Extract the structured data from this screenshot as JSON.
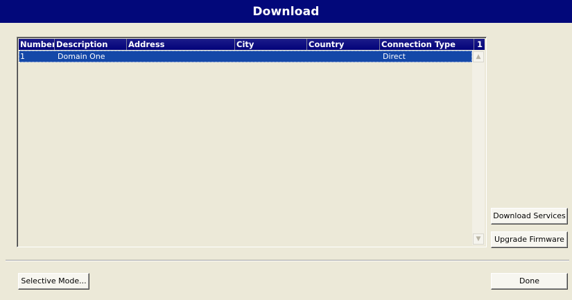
{
  "window": {
    "title": "Download"
  },
  "table": {
    "columns": [
      "Number",
      "Description",
      "Address",
      "City",
      "Country",
      "Connection Type",
      "1"
    ],
    "rows": [
      {
        "number": "1",
        "description": "Domain One",
        "address": "",
        "city": "",
        "country": "",
        "connection_type": "Direct"
      }
    ]
  },
  "scrollbar": {
    "up_icon": "chevron-up-icon",
    "down_icon": "chevron-down-icon"
  },
  "buttons": {
    "download_services": "Download Services",
    "upgrade_firmware": "Upgrade Firmware",
    "selective_mode": "Selective Mode...",
    "done": "Done"
  },
  "colors": {
    "title_bar": "#02087a",
    "header_bg": "#02027a",
    "selection": "#1448a8",
    "dialog_bg": "#ece9d8"
  }
}
